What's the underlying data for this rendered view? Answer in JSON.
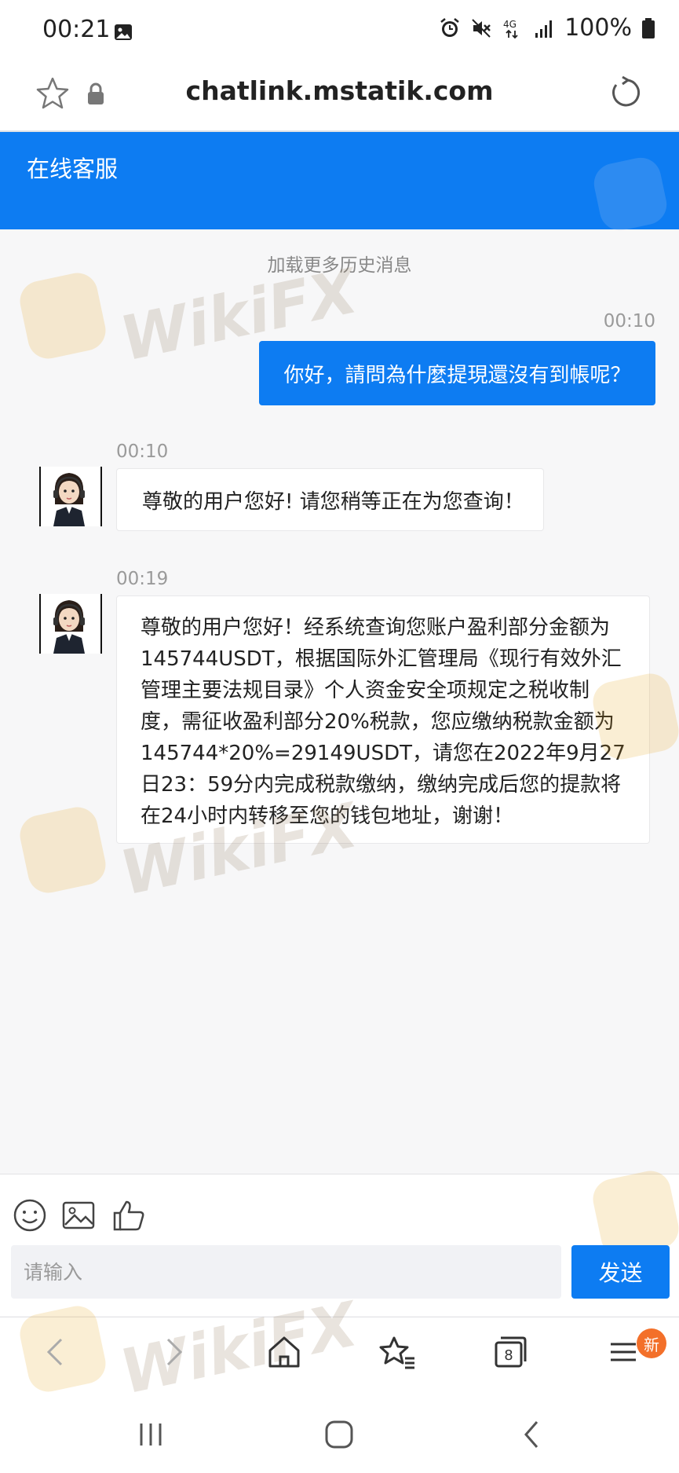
{
  "status_bar": {
    "time": "00:21",
    "battery_text": "100%",
    "icons": [
      "gallery-icon",
      "alarm-icon",
      "mute-icon",
      "4g-icon",
      "signal-icon",
      "battery-icon"
    ]
  },
  "browser": {
    "url": "chatlink.mstatik.com",
    "badge": "新"
  },
  "chat": {
    "title": "在线客服",
    "load_more": "加载更多历史消息",
    "messages": [
      {
        "sender": "user",
        "time": "00:10",
        "text": "你好，請問為什麼提現還沒有到帳呢？"
      },
      {
        "sender": "agent",
        "time": "00:10",
        "text": "尊敬的用户您好! 请您稍等正在为您查询！"
      },
      {
        "sender": "agent",
        "time": "00:19",
        "text": "尊敬的用户您好！经系统查询您账户盈利部分金额为145744USDT，根据国际外汇管理局《现行有效外汇管理主要法规目录》个人资金安全项规定之税收制度，需征收盈利部分20%税款，您应缴纳税款金额为145744*20%=29149USDT，请您在2022年9月27日23：59分内完成税款缴纳，缴纳完成后您的提款将在24小时内转移至您的钱包地址，谢谢！"
      }
    ]
  },
  "composer": {
    "placeholder": "请输入",
    "send_label": "发送"
  },
  "watermark": {
    "text": "WikiFX",
    "color": "#e8a317"
  },
  "colors": {
    "accent": "#0d7cf2",
    "badge": "#f3702a"
  }
}
